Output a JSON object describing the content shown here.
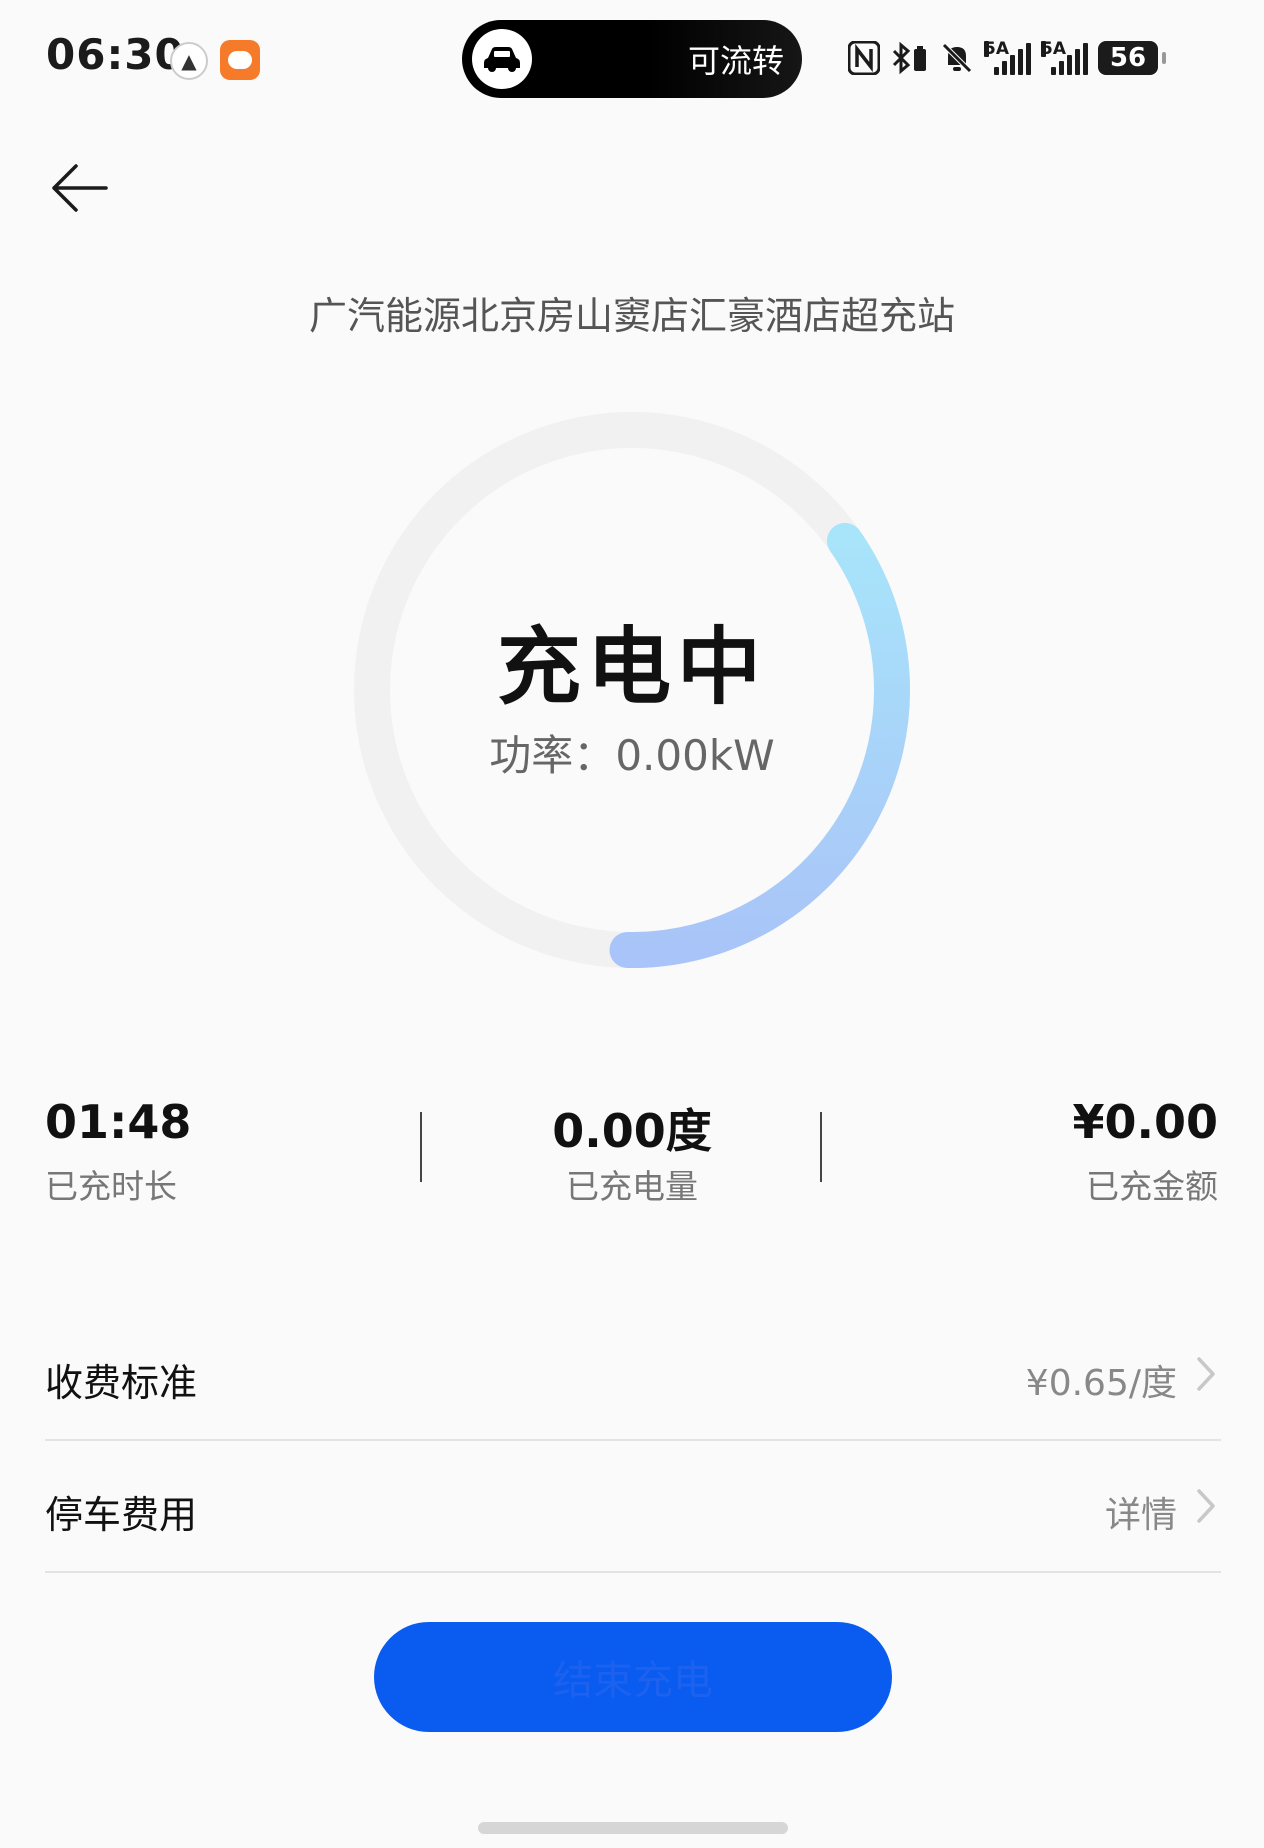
{
  "status_bar": {
    "time": "06:30",
    "island_text": "可流转",
    "network_1_label": "5A",
    "network_2_label": "5A",
    "battery_level": "56"
  },
  "header": {
    "station_name": "广汽能源北京房山窦店汇豪酒店超充站"
  },
  "charging": {
    "status": "充电中",
    "power_label": "功率：",
    "power_value": "0.00kW",
    "ring_progress": 0.35,
    "ring_colors": [
      "#a8e4fa",
      "#a9c4f8"
    ]
  },
  "stats": {
    "duration_value": "01:48",
    "duration_label": "已充时长",
    "energy_value": "0.00度",
    "energy_label": "已充电量",
    "amount_value": "¥0.00",
    "amount_label": "已充金额"
  },
  "rows": {
    "pricing_label": "收费标准",
    "pricing_value": "¥0.65/度",
    "parking_label": "停车费用",
    "parking_value": "详情"
  },
  "actions": {
    "stop_button_label": "结束充电",
    "accent_color": "#0a5cf0"
  }
}
